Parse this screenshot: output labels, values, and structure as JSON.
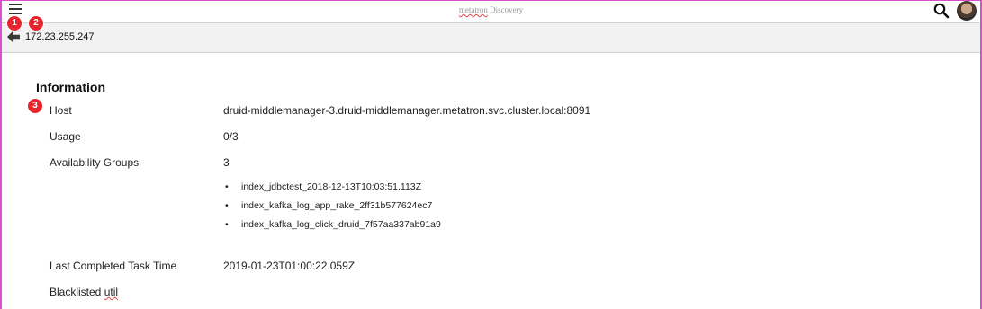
{
  "app": {
    "title_brand": "metatron",
    "title_rest": " Discovery"
  },
  "header": {
    "menu_icon": "hamburger-icon",
    "search_icon": "search-icon",
    "avatar": "user-avatar"
  },
  "breadcrumb": {
    "back_icon": "arrow-left-icon",
    "host": "172.23.255.247"
  },
  "badges": {
    "one": "1",
    "two": "2",
    "three": "3"
  },
  "info": {
    "title": "Information",
    "host_label": "Host",
    "host_value": "druid-middlemanager-3.druid-middlemanager.metatron.svc.cluster.local:8091",
    "usage_label": "Usage",
    "usage_value": "0/3",
    "groups_label": "Availability Groups",
    "groups_value": "3",
    "groups": [
      "index_jdbctest_2018-12-13T10:03:51.113Z",
      "index_kafka_log_app_rake_2ff31b577624ec7",
      "index_kafka_log_click_druid_7f57aa337ab91a9"
    ],
    "bullet": "•",
    "last_task_label": "Last Completed Task Time",
    "last_task_value": "2019-01-23T01:00:22.059Z",
    "blacklisted_label_a": "Blacklisted ",
    "blacklisted_label_b": "util"
  },
  "colors": {
    "badge": "#e8242c",
    "frame": "#d84fd0",
    "subbar": "#f2f2f2"
  }
}
